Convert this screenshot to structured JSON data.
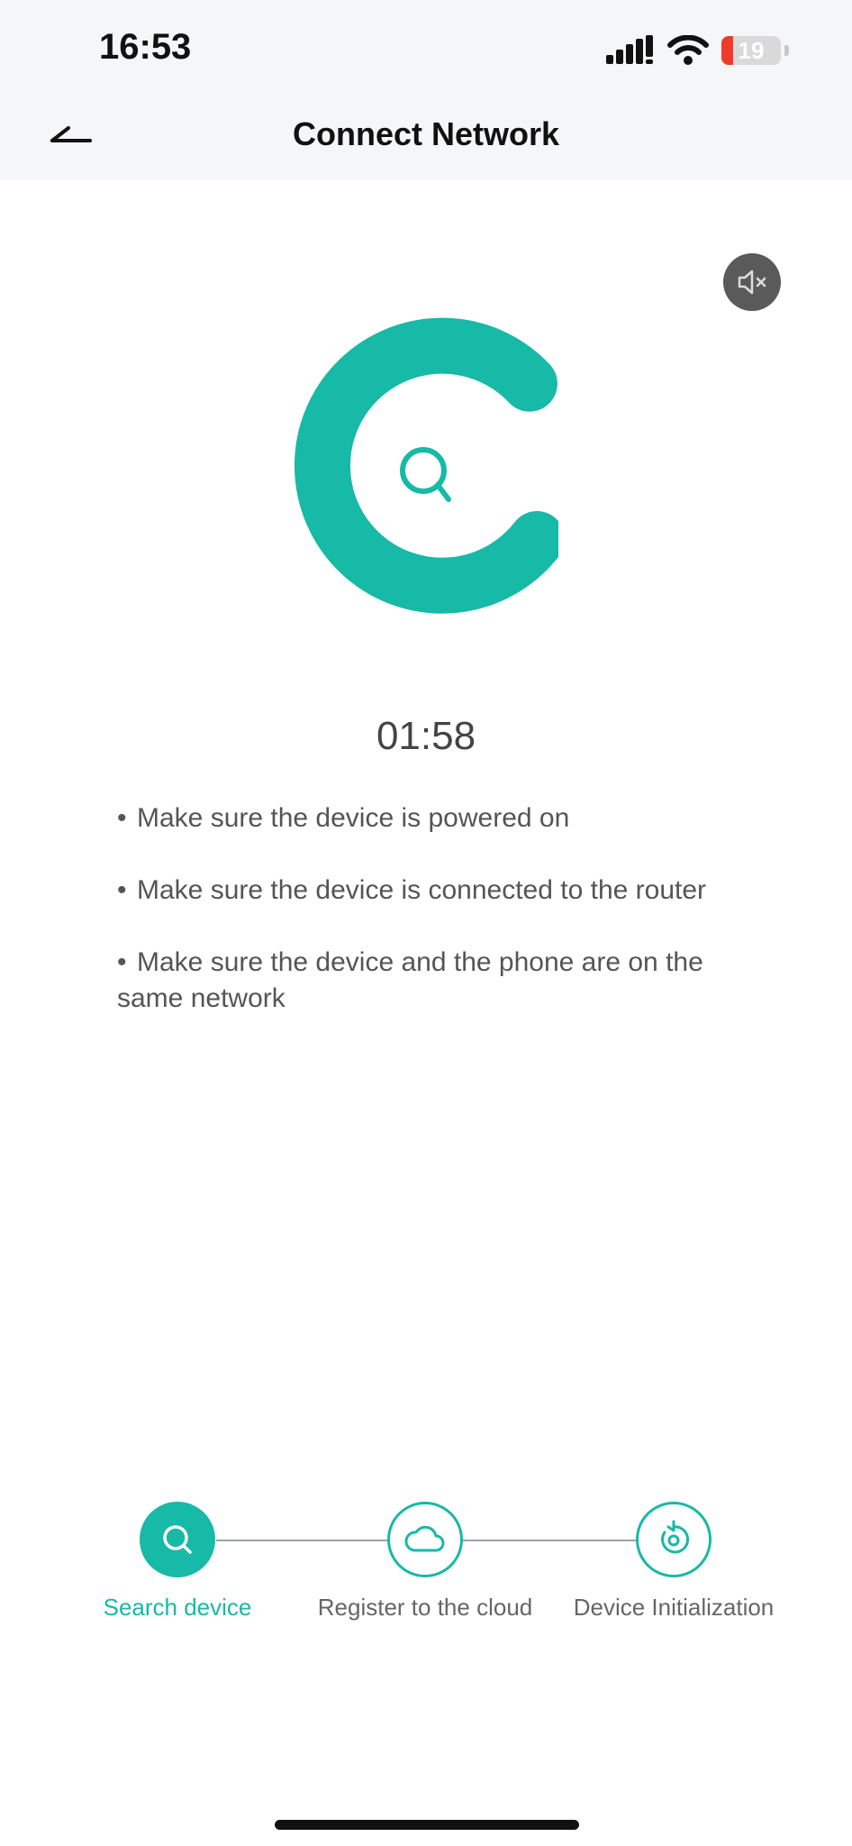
{
  "status_bar": {
    "time": "16:53",
    "battery": "19",
    "battery_level": 0.19
  },
  "nav": {
    "title": "Connect Network"
  },
  "timer": "01:58",
  "tips": [
    "Make sure the device is powered on",
    "Make sure the device is connected to the router",
    "Make sure the device and the phone are on the same network"
  ],
  "tip_bullet": "•",
  "steps": [
    {
      "label": "Search device",
      "state": "active",
      "icon": "search-icon"
    },
    {
      "label": "Register to the cloud",
      "state": "inactive",
      "icon": "cloud-icon"
    },
    {
      "label": "Device Initialization",
      "state": "inactive",
      "icon": "refresh-icon"
    }
  ],
  "colors": {
    "accent": "#17b9a7",
    "header_bg": "#f5f6f8",
    "battery_low": "#ef3b2d"
  }
}
